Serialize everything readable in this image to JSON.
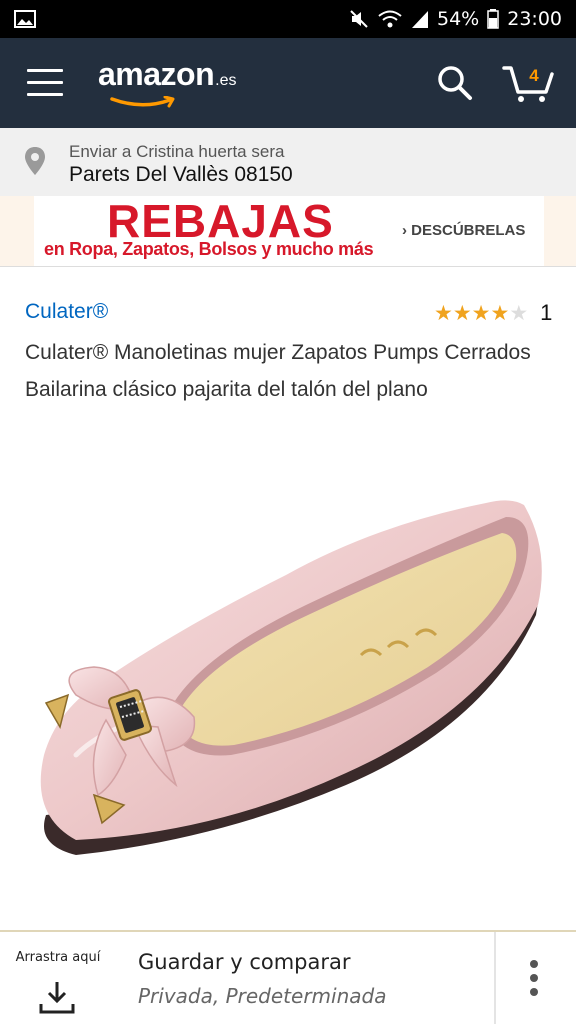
{
  "status_bar": {
    "battery": "54%",
    "time": "23:00"
  },
  "header": {
    "logo_word": "amazon",
    "logo_tld": ".es",
    "cart_count": "4",
    "colors": {
      "background": "#232f3e",
      "accent": "#ff9900"
    }
  },
  "delivery": {
    "line1": "Enviar a Cristina huerta sera",
    "line2": "Parets Del Vallès 08150"
  },
  "banner": {
    "title": "REBAJAS",
    "subtitle": "en Ropa, Zapatos, Bolsos y mucho más",
    "link": "› DESCÚBRELAS"
  },
  "product": {
    "brand": "Culater®",
    "rating_stars": 4,
    "rating_max": 5,
    "rating_count": "1",
    "title": "Culater® Manoletinas mujer Zapatos Pumps Cerrados Bailarina clásico pajarita del talón del plano"
  },
  "bottom_bar": {
    "drag_label": "Arrastra aquí",
    "save_label": "Guardar y comparar",
    "save_sub": "Privada, Predeterminada"
  }
}
